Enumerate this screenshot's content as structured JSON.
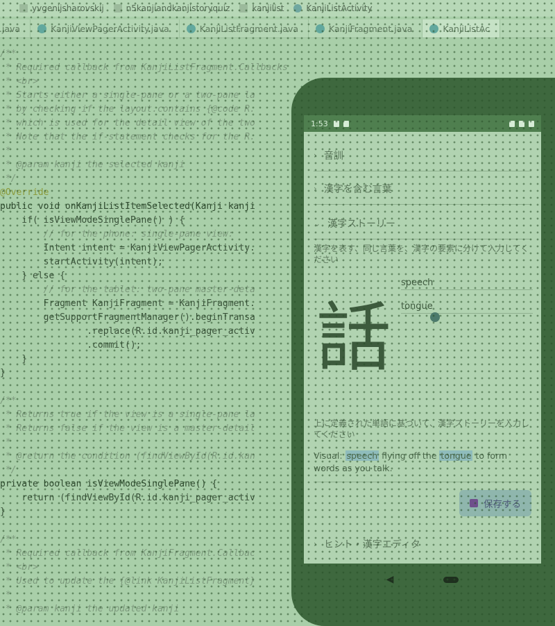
{
  "breadcrumb": [
    {
      "label": "yvgenijsharovskij",
      "icon": "folder-icon"
    },
    {
      "label": "n5kanjiandkanjistoryquiz",
      "icon": "folder-icon"
    },
    {
      "label": "kanjilist",
      "icon": "package-icon"
    },
    {
      "label": "KanjiListActivity",
      "icon": "class-icon"
    }
  ],
  "tabs": [
    {
      "label": "t.java",
      "active": false
    },
    {
      "label": "KanjiViewPagerActivity.java",
      "active": false
    },
    {
      "label": "KanjiListFragment.java",
      "active": false
    },
    {
      "label": "KanjiFragment.java",
      "active": false
    },
    {
      "label": "KanjiListAc",
      "active": true
    }
  ],
  "code": [
    {
      "text": "/**",
      "style": "comment"
    },
    {
      "text": " * Required callback from KanjiListFragment.Callbacks",
      "style": "comment"
    },
    {
      "text": " * <br>",
      "style": "comment"
    },
    {
      "text": " * Starts either a single-pane or a two-pane la",
      "style": "comment"
    },
    {
      "text": " * by checking if the layout.contains {@code R.",
      "style": "comment"
    },
    {
      "text": " * which is used for the detail view of the two",
      "style": "comment"
    },
    {
      "text": " * Note that the if-statement checks for the R.",
      "style": "comment"
    },
    {
      "text": " *",
      "style": "comment"
    },
    {
      "text": " * @param kanji the selected kanji",
      "style": "comment"
    },
    {
      "text": " */",
      "style": "comment"
    },
    {
      "text": "@Override",
      "style": "annotation"
    },
    {
      "text": "public void onKanjiListItemSelected(Kanji kanji",
      "style": "keyword"
    },
    {
      "text": "    if( isViewModeSinglePane() ) {",
      "style": "plain"
    },
    {
      "text": "        // for the phone: single-pane view:",
      "style": "comment"
    },
    {
      "text": "        Intent intent = KanjiViewPagerActivity.",
      "style": "plain"
    },
    {
      "text": "        startActivity(intent);",
      "style": "plain"
    },
    {
      "text": "    } else {",
      "style": "plain"
    },
    {
      "text": "        // for the tablet: two-pane master-deta",
      "style": "comment"
    },
    {
      "text": "        Fragment KanjiFragment = KanjiFragment.",
      "style": "plain"
    },
    {
      "text": "        getSupportFragmentManager().beginTransa",
      "style": "plain"
    },
    {
      "text": "                .replace(R.id.kanji_pager_activ",
      "style": "plain"
    },
    {
      "text": "                .commit();",
      "style": "plain"
    },
    {
      "text": "    }",
      "style": "plain"
    },
    {
      "text": "}",
      "style": "plain"
    },
    {
      "text": "",
      "style": "plain"
    },
    {
      "text": "/**",
      "style": "comment"
    },
    {
      "text": " * Returns true if the view is a single-pane la",
      "style": "comment"
    },
    {
      "text": " * Returns false if the view is a master-detail",
      "style": "comment"
    },
    {
      "text": " *",
      "style": "comment"
    },
    {
      "text": " * @return the condition (findViewById(R.id.kan",
      "style": "comment"
    },
    {
      "text": " */",
      "style": "comment"
    },
    {
      "text": "private boolean isViewModeSinglePane() {",
      "style": "keyword"
    },
    {
      "text": "    return (findViewById(R.id.kanji_pager_activ",
      "style": "plain"
    },
    {
      "text": "}",
      "style": "plain"
    },
    {
      "text": "",
      "style": "plain"
    },
    {
      "text": "/**",
      "style": "comment"
    },
    {
      "text": " * Required callback from KanjiFragment.Callbac",
      "style": "comment"
    },
    {
      "text": " * <br>",
      "style": "comment"
    },
    {
      "text": " * Used to update the {@link KanjiListFragment}",
      "style": "comment"
    },
    {
      "text": " *",
      "style": "comment"
    },
    {
      "text": " * @param kanji the updated kanji",
      "style": "comment"
    }
  ],
  "phone": {
    "status_time": "1:53",
    "rows": [
      {
        "label": "音訓"
      },
      {
        "label": "漢字を含む言葉"
      },
      {
        "label": "漢字ストーリー"
      }
    ],
    "keyword_hint": "漢字を表す、同じ言葉を、漢字の要素に分けて入力してください",
    "keywords": [
      "speech",
      "tongue"
    ],
    "kanji": "話",
    "story_hint": "上に定義された単語に基づいて、漢字ストーリーを入力してください",
    "story": {
      "prefix": "Visual: ",
      "kw1": "speech",
      "mid": " flying off the ",
      "kw2": "tongue",
      "suffix": " to form words as you talk."
    },
    "save_label": "保存する",
    "bottom_row": "ヒント・漢字エディタ"
  }
}
